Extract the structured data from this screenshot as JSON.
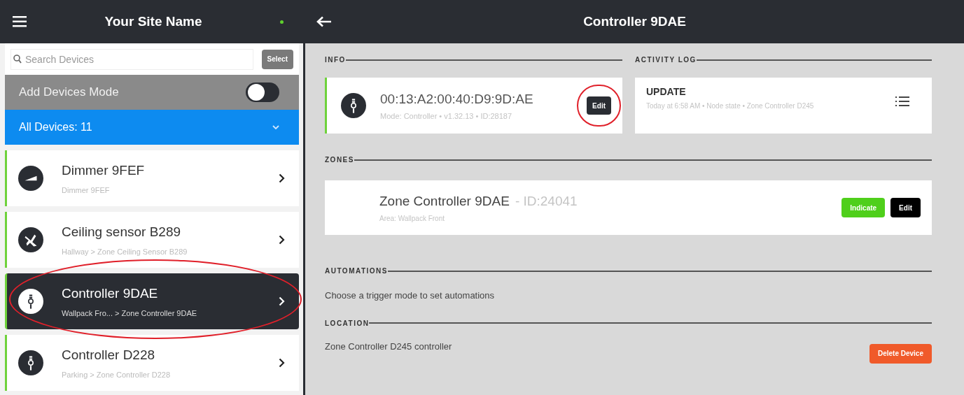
{
  "sidebar": {
    "title": "Your Site Name",
    "online": true,
    "search": {
      "placeholder": "Search Devices"
    },
    "select_button": "Select",
    "add_devices_mode": {
      "label": "Add Devices Mode",
      "on": false
    },
    "filter": {
      "label": "All Devices: 11",
      "expanded": false
    },
    "devices": [
      {
        "name": "Dimmer 9FEF",
        "subtitle": "Dimmer 9FEF",
        "kind": "dimmer",
        "selected": false,
        "circled": false
      },
      {
        "name": "Ceiling sensor B289",
        "subtitle": "Hallway > Zone Ceiling Sensor B289",
        "kind": "sensor",
        "selected": false,
        "circled": false
      },
      {
        "name": "Controller 9DAE",
        "subtitle": "Wallpack Fro... > Zone Controller 9DAE",
        "kind": "controller",
        "selected": true,
        "circled": true
      },
      {
        "name": "Controller D228",
        "subtitle": "Parking > Zone Controller D228",
        "kind": "controller",
        "selected": false,
        "circled": false
      }
    ]
  },
  "detail": {
    "title": "Controller 9DAE",
    "info": {
      "heading": "INFO",
      "address": "00:13:A2:00:40:D9:9D:AE",
      "meta": "Mode: Controller • v1.32.13 • ID:28187",
      "edit": "Edit",
      "edit_circled": true
    },
    "activity_log": {
      "heading": "ACTIVITY LOG",
      "event": "UPDATE",
      "detail": "Today at 6:58 AM • Node state • Zone Controller D245"
    },
    "zones": {
      "heading": "ZONES",
      "items": [
        {
          "name": "Zone Controller 9DAE",
          "id": "- ID:24041",
          "area": "Area: Wallpack Front",
          "indicate": "Indicate",
          "edit": "Edit"
        }
      ]
    },
    "automations": {
      "heading": "AUTOMATIONS",
      "text": "Choose a trigger mode to set automations"
    },
    "location": {
      "heading": "LOCATION",
      "text": "Zone Controller D245 controller",
      "delete": "Delete Device"
    }
  }
}
